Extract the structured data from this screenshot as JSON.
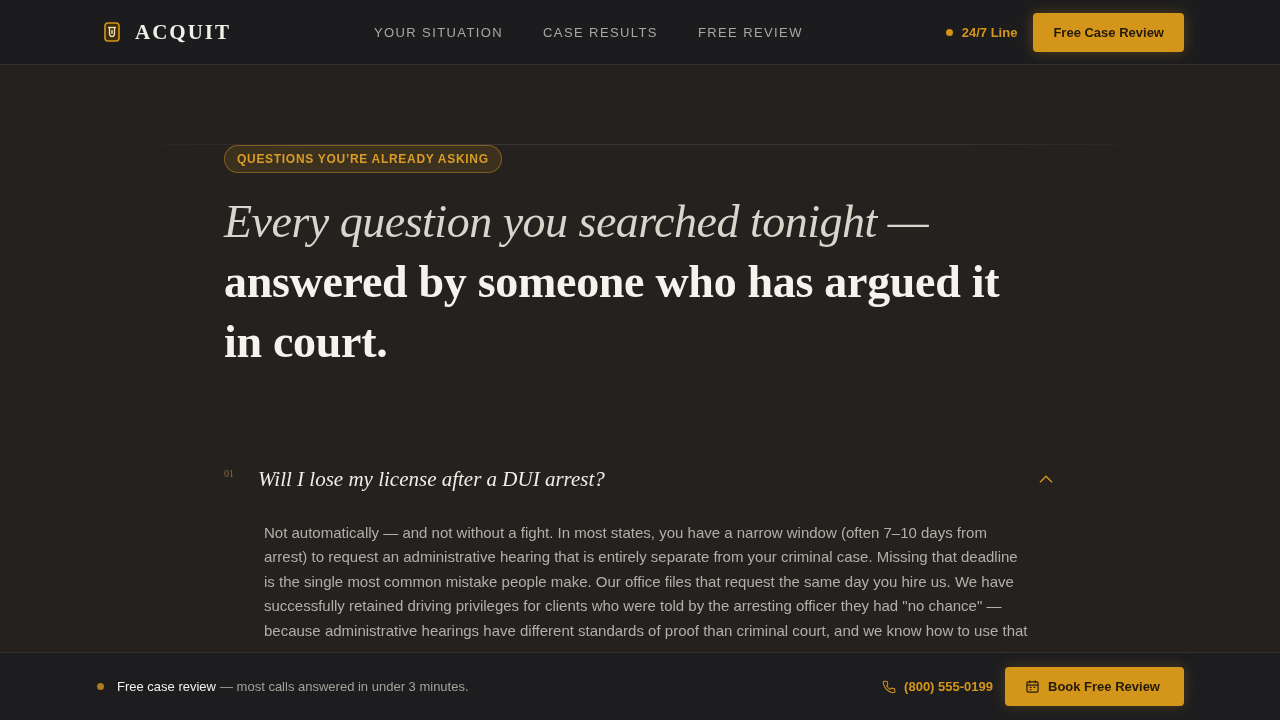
{
  "header": {
    "logo": "ACQUIT",
    "nav": [
      "YOUR SITUATION",
      "CASE RESULTS",
      "FREE REVIEW"
    ],
    "hotline": "24/7 Line",
    "cta": "Free Case Review"
  },
  "hero": {
    "badge": "QUESTIONS YOU’RE ALREADY ASKING",
    "headline_lead": "Every question you searched tonight —",
    "headline_main": "answered by someone who has argued it in court."
  },
  "faq": [
    {
      "number": "01",
      "question": "Will I lose my license after a DUI arrest?",
      "expanded": true,
      "answer": "Not automatically — and not without a fight. In most states, you have a narrow window (often 7–10 days from arrest) to request an administrative hearing that is entirely separate from your criminal case. Missing that deadline is the single most common mistake people make. Our office files that request the same day you hire us. We have successfully retained driving privileges for clients who were told by the arresting officer they had \"no chance\" — because administrative hearings have different standards of proof than criminal court, and we know how to use that"
    }
  ],
  "sticky_bar": {
    "lead": "Free case review",
    "text": "— most calls answered in under 3 minutes.",
    "phone": "(800) 555-0199",
    "button": "Book Free Review"
  }
}
